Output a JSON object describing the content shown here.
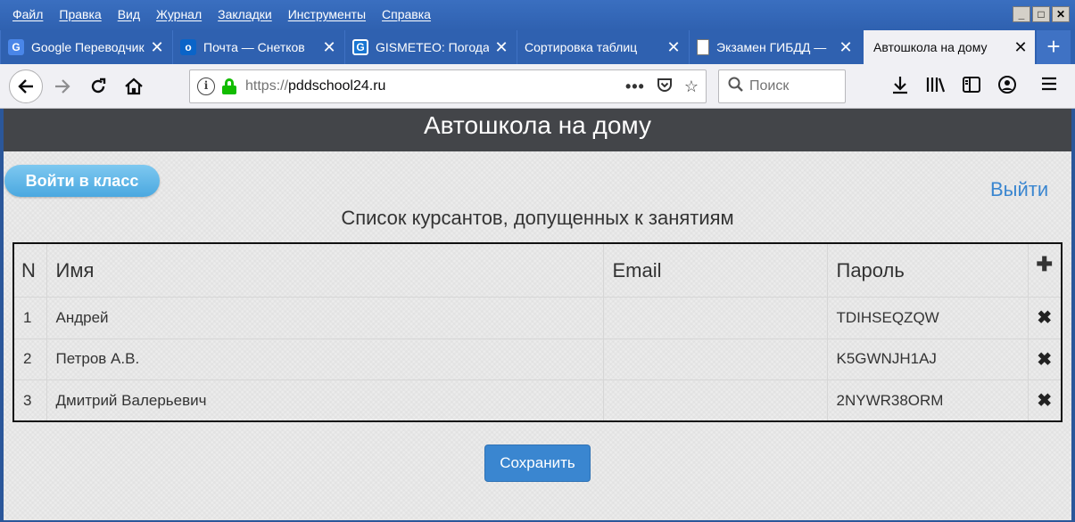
{
  "menu": [
    "Файл",
    "Правка",
    "Вид",
    "Журнал",
    "Закладки",
    "Инструменты",
    "Справка"
  ],
  "window_controls": [
    "_",
    "□",
    "✕"
  ],
  "tabs": [
    {
      "title": "Google Переводчик",
      "icon": "google-translate-icon",
      "color": "#4a86e8",
      "glyph": "G"
    },
    {
      "title": "Почта — Снетков",
      "icon": "outlook-icon",
      "color": "#0a64c8",
      "glyph": "o"
    },
    {
      "title": "GISMETEO: Погода",
      "icon": "gismeteo-icon",
      "color": "#1976d2",
      "glyph": "G"
    },
    {
      "title": "Сортировка таблиц",
      "icon": "",
      "color": "",
      "glyph": ""
    },
    {
      "title": "Экзамен ГИБДД —",
      "icon": "document-icon",
      "color": "#ffffff",
      "glyph": ""
    },
    {
      "title": "Автошкола на дому",
      "icon": "",
      "color": "",
      "glyph": "",
      "active": true
    }
  ],
  "navbar": {
    "url_scheme": "https://",
    "url_host": "pddschool24.ru",
    "search_placeholder": "Поиск"
  },
  "page": {
    "header": "Автошкола на дому",
    "enter_button": "Войти в класс",
    "logout": "Выйти",
    "list_title": "Список курсантов, допущенных к занятиям",
    "columns": {
      "n": "N",
      "name": "Имя",
      "email": "Email",
      "password": "Пароль",
      "add": "✚"
    },
    "rows": [
      {
        "n": "1",
        "name": "Андрей",
        "email": "",
        "password": "TDIHSEQZQW"
      },
      {
        "n": "2",
        "name": "Петров А.В.",
        "email": "",
        "password": "K5GWNJH1AJ"
      },
      {
        "n": "3",
        "name": "Дмитрий Валерьевич",
        "email": "",
        "password": "2NYWR38ORM"
      }
    ],
    "delete_glyph": "✖",
    "save_button": "Сохранить"
  },
  "colors": {
    "header_bg": "#434549",
    "accent": "#3a86d0",
    "titlebar": "#2f61b0"
  }
}
